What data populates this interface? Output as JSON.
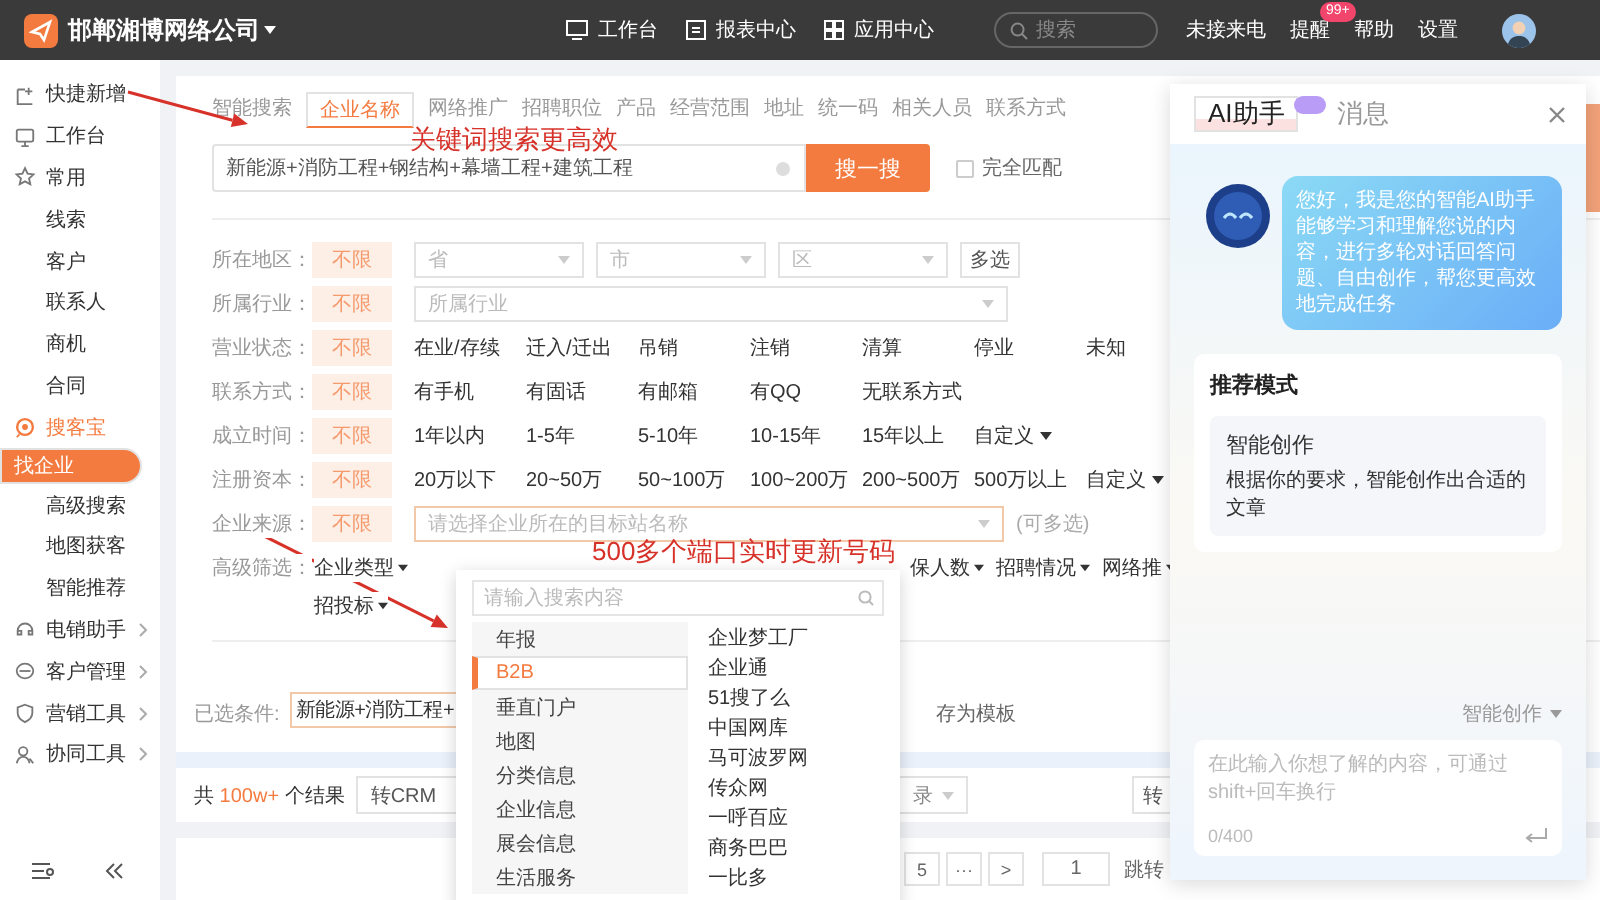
{
  "header": {
    "company": "邯郸湘博网络公司",
    "nav": [
      {
        "label": "工作台"
      },
      {
        "label": "报表中心"
      },
      {
        "label": "应用中心"
      }
    ],
    "search": {
      "placeholder": "搜索"
    },
    "links": [
      {
        "label": "未接来电"
      },
      {
        "label": "提醒",
        "badge": "99+"
      },
      {
        "label": "帮助"
      },
      {
        "label": "设置"
      }
    ]
  },
  "sidebar": {
    "items": [
      {
        "label": "快捷新增",
        "selected": false
      },
      {
        "label": "工作台",
        "selected": false
      },
      {
        "label": "常用",
        "selected": false,
        "expanded": true,
        "children": [
          {
            "label": "线索",
            "selected": false
          },
          {
            "label": "客户",
            "selected": false
          },
          {
            "label": "联系人",
            "selected": false
          },
          {
            "label": "商机",
            "selected": false
          },
          {
            "label": "合同",
            "selected": false
          }
        ]
      },
      {
        "label": "搜客宝",
        "selected": false,
        "expanded": true,
        "children": [
          {
            "label": "找企业",
            "selected": true
          },
          {
            "label": "高级搜索",
            "selected": false
          },
          {
            "label": "地图获客",
            "selected": false
          },
          {
            "label": "智能推荐",
            "selected": false
          }
        ]
      },
      {
        "label": "电销助手",
        "selected": false,
        "expanded": false
      },
      {
        "label": "客户管理",
        "selected": false,
        "expanded": false
      },
      {
        "label": "营销工具",
        "selected": false,
        "expanded": false
      },
      {
        "label": "协同工具",
        "selected": false,
        "expanded": false
      }
    ]
  },
  "search_tabs": [
    {
      "label": "智能搜索",
      "selected": false
    },
    {
      "label": "企业名称",
      "selected": true
    },
    {
      "label": "网络推广",
      "selected": false
    },
    {
      "label": "招聘职位",
      "selected": false
    },
    {
      "label": "产品",
      "selected": false
    },
    {
      "label": "经营范围",
      "selected": false
    },
    {
      "label": "地址",
      "selected": false
    },
    {
      "label": "统一码",
      "selected": false
    },
    {
      "label": "相关人员",
      "selected": false
    },
    {
      "label": "联系方式",
      "selected": false
    }
  ],
  "search": {
    "value": "新能源+消防工程+钢结构+幕墙工程+建筑工程",
    "button": "搜一搜",
    "exact_match": {
      "label": "完全匹配",
      "checked": false
    }
  },
  "filters": [
    {
      "kind": "region",
      "label": "所在地区：",
      "all": "不限",
      "selects": [
        {
          "placeholder": "省"
        },
        {
          "placeholder": "市"
        },
        {
          "placeholder": "区"
        }
      ],
      "button": "多选"
    },
    {
      "kind": "select",
      "label": "所属行业：",
      "all": "不限",
      "placeholder": "所属行业"
    },
    {
      "kind": "options",
      "label": "营业状态：",
      "all": "不限",
      "options": [
        "在业/存续",
        "迁入/迁出",
        "吊销",
        "注销",
        "清算",
        "停业",
        "未知"
      ]
    },
    {
      "kind": "options",
      "label": "联系方式：",
      "all": "不限",
      "options": [
        "有手机",
        "有固话",
        "有邮箱",
        "有QQ",
        "无联系方式"
      ]
    },
    {
      "kind": "options",
      "label": "成立时间：",
      "all": "不限",
      "options": [
        "1年以内",
        "1-5年",
        "5-10年",
        "10-15年",
        "15年以上"
      ],
      "custom": "自定义"
    },
    {
      "kind": "options",
      "label": "注册资本：",
      "all": "不限",
      "options": [
        "20万以下",
        "20~50万",
        "50~100万",
        "100~200万",
        "200~500万",
        "500万以上"
      ],
      "custom": "自定义"
    },
    {
      "kind": "source",
      "label": "企业来源：",
      "all": "不限",
      "placeholder": "请选择企业所在的目标站名称",
      "hint": "(可多选)"
    },
    {
      "kind": "advanced",
      "label": "高级筛选：",
      "dropdowns": [
        "企业类型",
        "保人数",
        "招聘情况",
        "网络推"
      ],
      "second_line": [
        "招投标"
      ]
    }
  ],
  "selected_conditions": {
    "label": "已选条件:",
    "tag": "新能源+消防工程+",
    "save": "存为模板"
  },
  "results": {
    "prefix": "共",
    "count": "100w+",
    "suffix": "个结果",
    "button": "转CRM",
    "select": "录",
    "button_2": "转"
  },
  "pagination": {
    "pages": [
      "5",
      "···"
    ],
    "next": ">",
    "page_input": "1",
    "jump": "跳转"
  },
  "source_popup": {
    "search": {
      "placeholder": "请输入搜索内容"
    },
    "categories": [
      {
        "label": "年报",
        "selected": false
      },
      {
        "label": "B2B",
        "selected": true
      },
      {
        "label": "垂直门户",
        "selected": false
      },
      {
        "label": "地图",
        "selected": false
      },
      {
        "label": "分类信息",
        "selected": false
      },
      {
        "label": "企业信息",
        "selected": false
      },
      {
        "label": "展会信息",
        "selected": false
      },
      {
        "label": "生活服务",
        "selected": false
      }
    ],
    "sites": [
      "企业梦工厂",
      "企业通",
      "51搜了么",
      "中国网库",
      "马可波罗网",
      "传众网",
      "一呼百应",
      "商务巴巴",
      "一比多"
    ]
  },
  "annotations": [
    {
      "text": "关键词搜索更高效"
    },
    {
      "text": "500多个端口实时更新号码"
    }
  ],
  "ai_panel": {
    "tabs": [
      {
        "label": "AI助手",
        "selected": true
      },
      {
        "label": "消息",
        "selected": false
      }
    ],
    "greeting": "您好，我是您的智能AI助手能够学习和理解您说的内容，进行多轮对话回答问题、自由创作，帮您更高效地完成任务",
    "recommend": {
      "title": "推荐模式",
      "items": [
        {
          "title": "智能创作",
          "desc": "根据你的要求，智能创作出合适的文章"
        }
      ]
    },
    "mode": "智能创作",
    "input": {
      "placeholder": "在此输入你想了解的内容，可通过shift+回车换行",
      "count": "0/400"
    }
  }
}
